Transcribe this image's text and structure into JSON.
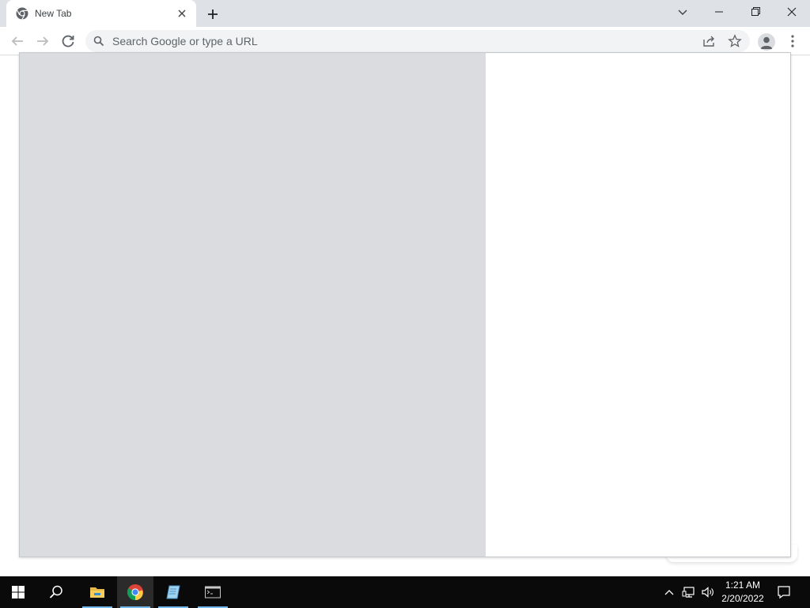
{
  "browser": {
    "tab": {
      "title": "New Tab",
      "favicon": "chrome-icon"
    },
    "omnibox": {
      "placeholder": "Search Google or type a URL",
      "value": ""
    },
    "icons": {
      "back": "arrow-left-icon",
      "forward": "arrow-right-icon",
      "reload": "reload-icon",
      "share": "share-icon",
      "bookmark": "star-icon",
      "profile": "person-icon",
      "menu": "kebab-menu-icon",
      "new_tab": "plus-icon",
      "tab_search": "chevron-down-icon",
      "minimize": "minimize-icon",
      "restore": "restore-icon",
      "close": "close-icon"
    }
  },
  "taskbar": {
    "apps": [
      "windows-start-icon",
      "search-icon",
      "file-explorer-icon",
      "chrome-icon",
      "notepad-icon",
      "command-prompt-icon"
    ],
    "clock": {
      "time": "1:21 AM",
      "date": "2/20/2022"
    },
    "tray": [
      "chevron-up-icon",
      "network-icon",
      "volume-icon",
      "notification-icon"
    ]
  },
  "colors": {
    "tabstrip": "#dee1e6",
    "omnibox": "#f1f3f4",
    "panel_left": "#dadce0",
    "taskbar": "#0a0a0a",
    "active_underline": "#76b9ed"
  }
}
